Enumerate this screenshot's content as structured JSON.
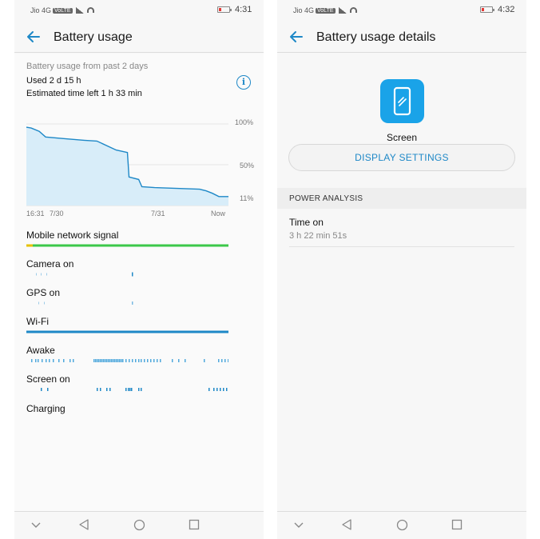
{
  "left": {
    "status": {
      "carrier": "Jio 4G",
      "volte": "VoLTE",
      "time": "4:31"
    },
    "header": {
      "title": "Battery usage"
    },
    "summary": {
      "period": "Battery usage from past 2 days",
      "used": "Used 2 d 15 h",
      "estimated": "Estimated time left 1 h 33 min",
      "info_icon": "info-icon"
    },
    "chart_data": {
      "type": "area",
      "x_tick_labels": [
        "16:31",
        "7/30",
        "7/31",
        "Now"
      ],
      "y_tick_labels": [
        "100%",
        "50%",
        "11%"
      ],
      "ylim": [
        0,
        100
      ],
      "x_range_hours": [
        0,
        63
      ],
      "series": [
        {
          "x": [
            0,
            1.5,
            4,
            6,
            12,
            18,
            22,
            28,
            31.5,
            32,
            35,
            36,
            40,
            47,
            54,
            56,
            58,
            60,
            63
          ],
          "y": [
            96,
            95,
            91,
            84,
            82,
            80,
            79,
            68,
            65,
            35,
            32,
            23,
            22,
            21,
            20,
            18,
            15,
            11,
            11
          ]
        }
      ],
      "grid": true,
      "color": "#1e88c7"
    },
    "usage_rows": [
      {
        "label": "Mobile network signal",
        "kind": "signal"
      },
      {
        "label": "Camera on",
        "kind": "camera"
      },
      {
        "label": "GPS on",
        "kind": "gps"
      },
      {
        "label": "Wi-Fi",
        "kind": "wifi"
      },
      {
        "label": "Awake",
        "kind": "awake"
      },
      {
        "label": "Screen on",
        "kind": "screen"
      },
      {
        "label": "Charging",
        "kind": "charging"
      }
    ]
  },
  "right": {
    "status": {
      "carrier": "Jio 4G",
      "volte": "VoLTE",
      "time": "4:32"
    },
    "header": {
      "title": "Battery usage details"
    },
    "app": {
      "name": "Screen",
      "icon": "phone-screen-icon",
      "color": "#1aa3e8"
    },
    "button": {
      "label": "DISPLAY SETTINGS"
    },
    "section": {
      "title": "POWER ANALYSIS"
    },
    "detail": {
      "title": "Time on",
      "value": "3 h 22 min 51s"
    }
  },
  "colors": {
    "accent": "#1e88c7",
    "signal_good": "#3cc84a",
    "signal_weak": "#e5c100",
    "wifi": "#1e88c7"
  }
}
